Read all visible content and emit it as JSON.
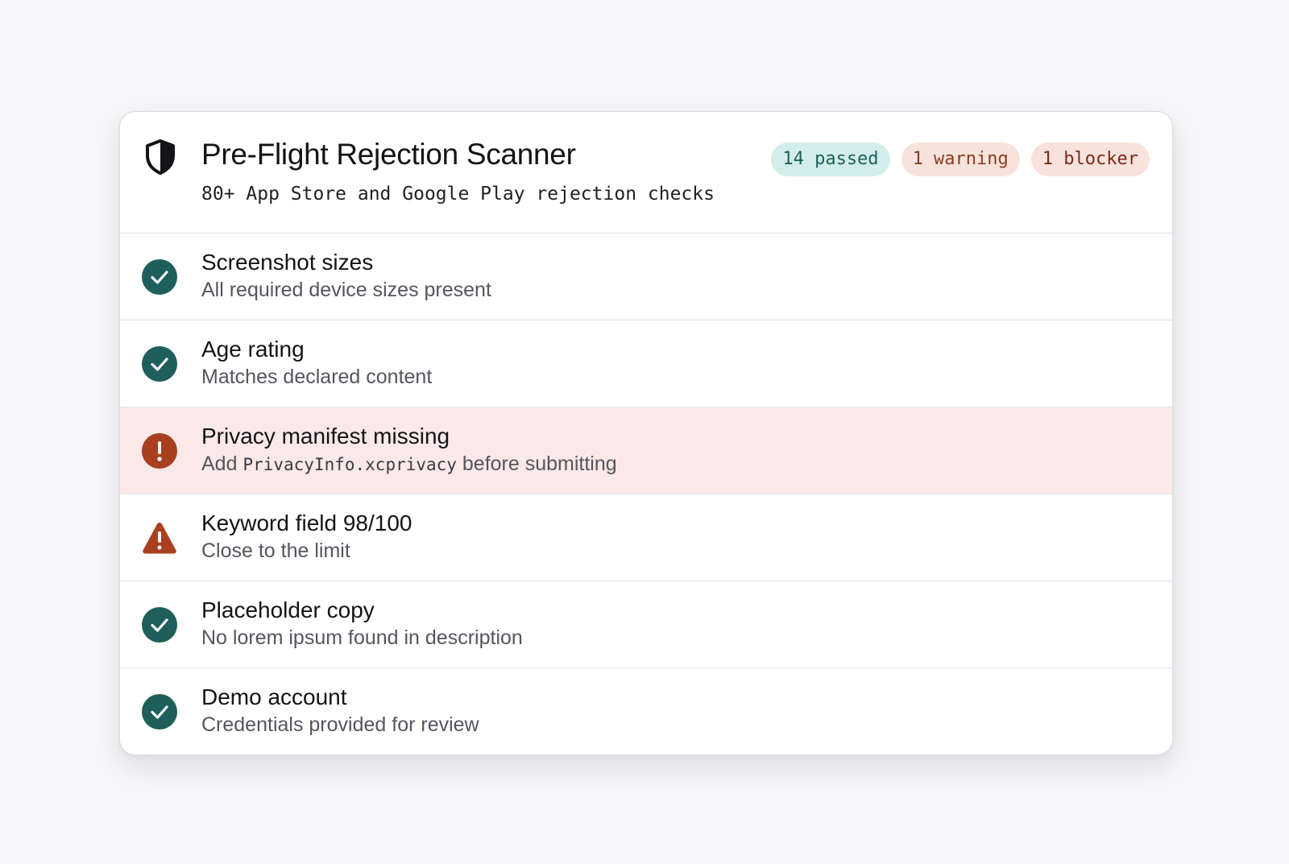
{
  "header": {
    "title": "Pre-Flight Rejection Scanner",
    "subtitle": "80+ App Store and Google Play rejection checks",
    "icon": "shield-icon",
    "badges": {
      "passed": "14 passed",
      "warning": "1 warning",
      "blocker": "1 blocker"
    }
  },
  "checks": [
    {
      "status": "pass",
      "icon": "check-circle-icon",
      "title": "Screenshot sizes",
      "description": "All required device sizes present"
    },
    {
      "status": "pass",
      "icon": "check-circle-icon",
      "title": "Age rating",
      "description": "Matches declared content"
    },
    {
      "status": "blocker",
      "icon": "exclamation-circle-icon",
      "title": "Privacy manifest missing",
      "description_prefix": "Add ",
      "description_code": "PrivacyInfo.xcprivacy",
      "description_suffix": " before submitting"
    },
    {
      "status": "warning",
      "icon": "warning-triangle-icon",
      "title": "Keyword field 98/100",
      "description": "Close to the limit"
    },
    {
      "status": "pass",
      "icon": "check-circle-icon",
      "title": "Placeholder copy",
      "description": "No lorem ipsum found in description"
    },
    {
      "status": "pass",
      "icon": "check-circle-icon",
      "title": "Demo account",
      "description": "Credentials provided for review"
    }
  ],
  "colors": {
    "pass": "#1e5f5c",
    "blocker": "#a8401f",
    "warning": "#a8401f",
    "blocker_row_bg": "#fbe8e8"
  }
}
